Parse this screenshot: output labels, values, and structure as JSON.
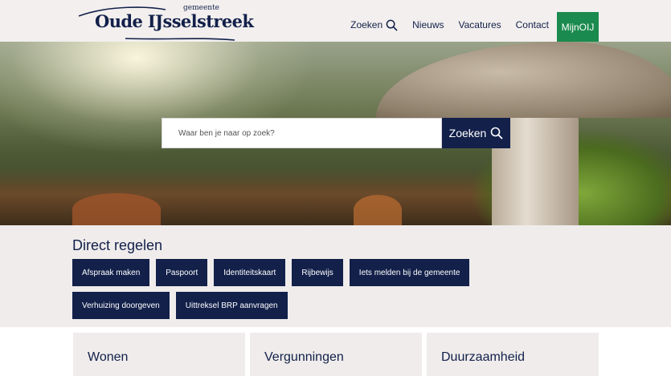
{
  "header": {
    "logo_small": "gemeente",
    "logo_main": "Oude IJsselstreek",
    "nav": {
      "search_label": "Zoeken",
      "news_label": "Nieuws",
      "jobs_label": "Vacatures",
      "contact_label": "Contact",
      "mijn_label": "MijnOIJ"
    }
  },
  "hero": {
    "search_placeholder": "Waar ben je naar op zoek?",
    "search_button": "Zoeken"
  },
  "direct": {
    "title": "Direct regelen",
    "buttons": [
      "Afspraak maken",
      "Paspoort",
      "Identiteitskaart",
      "Rijbewijs",
      "Iets melden bij de gemeente",
      "Verhuizing doorgeven",
      "Uittreksel BRP aanvragen"
    ]
  },
  "cards": [
    "Wonen",
    "Vergunningen",
    "Duurzaamheid"
  ],
  "colors": {
    "navy": "#12204a",
    "green": "#1a8a4e",
    "background": "#efeceb"
  },
  "icons": {
    "search": "search-icon"
  }
}
